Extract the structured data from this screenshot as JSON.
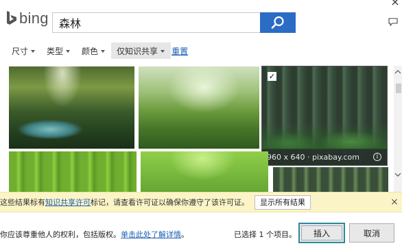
{
  "window": {
    "close_label": "×"
  },
  "header": {
    "logo_text": "bing",
    "search_value": "森林",
    "brand_color": "#2b6cc4",
    "feedback_icon": "feedback-icon"
  },
  "filters": [
    {
      "label": "尺寸"
    },
    {
      "label": "类型"
    },
    {
      "label": "颜色"
    },
    {
      "label": "仅知识共享"
    }
  ],
  "reset_label": "重置",
  "gallery": {
    "selected_tile": {
      "checkbox": "✓",
      "caption": "960 x 640 · pixabay.com",
      "info": "i"
    }
  },
  "license_bar": {
    "text_before": "这些结果标有",
    "link": "知识共享许可",
    "text_after": "标记，请查看许可证以确保你遵守了该许可证。",
    "show_all": "显示所有结果",
    "close": "×"
  },
  "footer": {
    "text_before": "你应该尊重他人的权利，包括版权。",
    "link": "单击此处了解详情",
    "text_after": "。",
    "selected_count": "已选择 1 个项目。",
    "insert_label": "插入",
    "cancel_label": "取消"
  }
}
